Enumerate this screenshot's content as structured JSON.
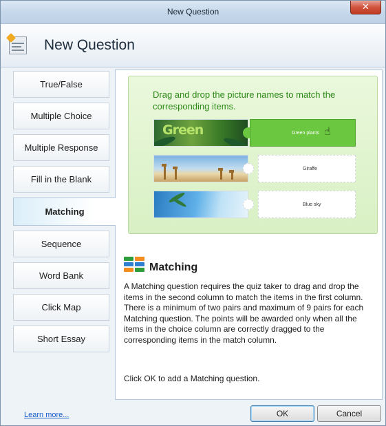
{
  "window": {
    "title": "New Question",
    "close_label": "✕"
  },
  "header": {
    "title": "New Question"
  },
  "sidebar": {
    "items": [
      {
        "label": "True/False",
        "active": false
      },
      {
        "label": "Multiple Choice",
        "active": false
      },
      {
        "label": "Multiple Response",
        "active": false
      },
      {
        "label": "Fill in the Blank",
        "active": false
      },
      {
        "label": "Matching",
        "active": true
      },
      {
        "label": "Sequence",
        "active": false
      },
      {
        "label": "Word Bank",
        "active": false
      },
      {
        "label": "Click Map",
        "active": false
      },
      {
        "label": "Short Essay",
        "active": false
      }
    ]
  },
  "preview": {
    "instruction": "Drag and drop the picture names to match the corresponding items.",
    "pairs": [
      {
        "image": "green-plants-image",
        "label": "Green plants"
      },
      {
        "image": "giraffe-image",
        "label": "Giraffe"
      },
      {
        "image": "blue-sky-image",
        "label": "Blue sky"
      }
    ],
    "image_text": "Green"
  },
  "info": {
    "title": "Matching",
    "description": "A Matching question requires the quiz taker to drag and drop the items in the second column to match the items in the first column. There is a minimum of two pairs and maximum of 9 pairs for each Matching question. The points will be awarded only when all the items in the choice column are correctly dragged to the corresponding items in the match column.",
    "cta": "Click OK to add a Matching question."
  },
  "footer": {
    "learn_more": "Learn more...",
    "ok_label": "OK",
    "cancel_label": "Cancel"
  },
  "colors": {
    "accent_green": "#2d8a18",
    "selected_tile": "#6bc73f",
    "link": "#1a5fc8"
  }
}
